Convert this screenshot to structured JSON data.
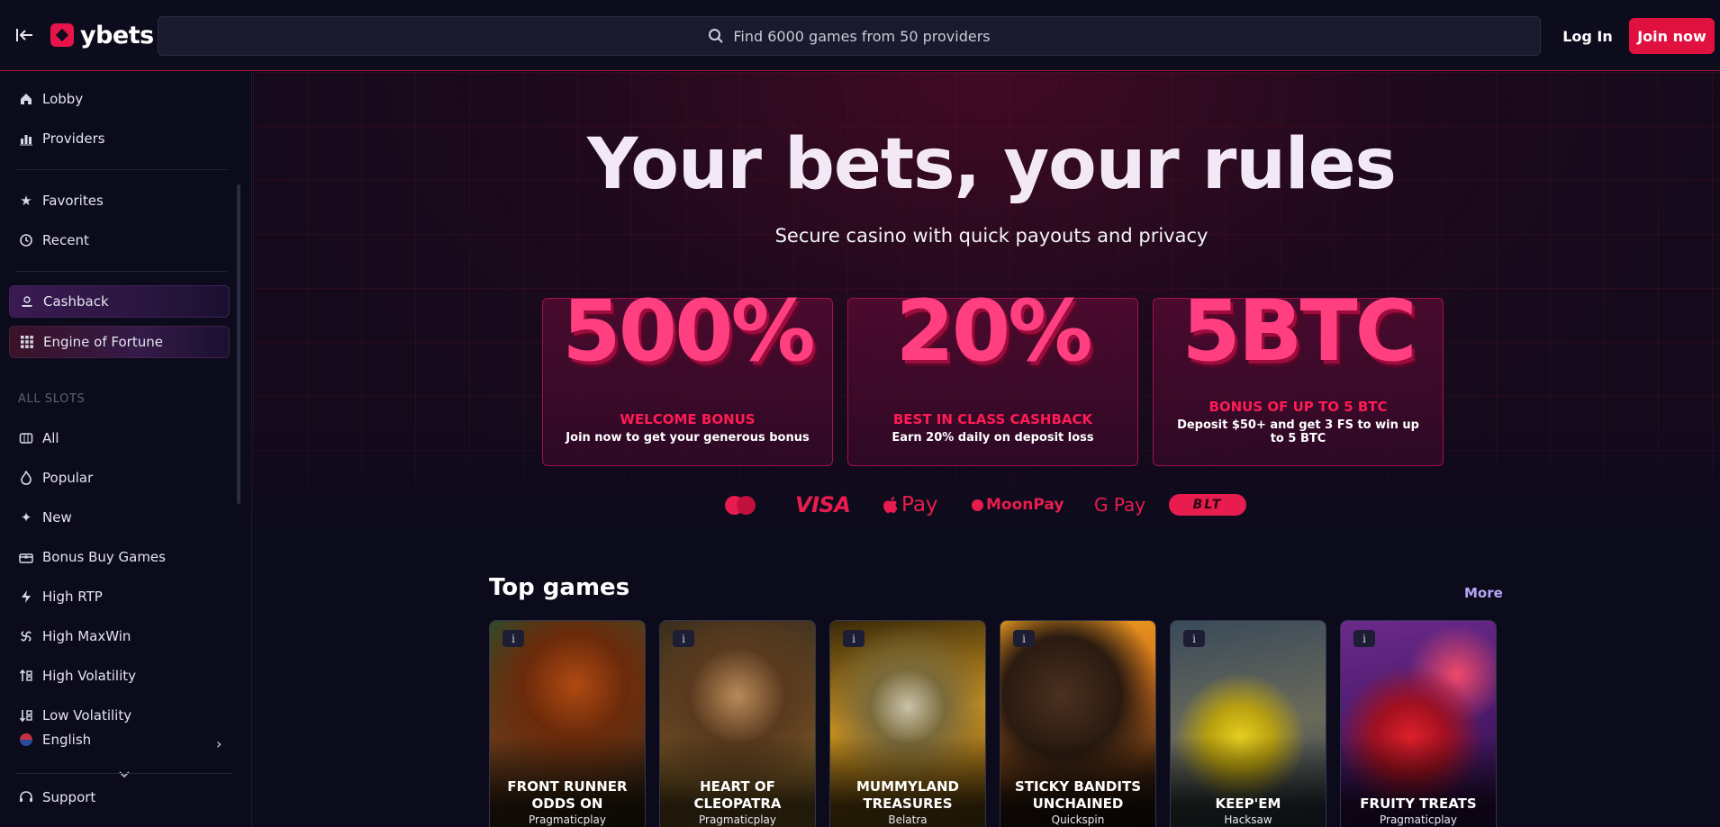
{
  "header": {
    "logo_text": "ybets",
    "search_placeholder": "Find 6000 games from 50 providers",
    "login_label": "Log In",
    "join_label": "Join now"
  },
  "sidebar": {
    "items": [
      {
        "label": "Lobby",
        "icon": "home-icon"
      },
      {
        "label": "Providers",
        "icon": "chart-icon"
      },
      {
        "label": "Favorites",
        "icon": "star-icon"
      },
      {
        "label": "Recent",
        "icon": "history-icon"
      },
      {
        "label": "Cashback",
        "icon": "cashback-icon"
      },
      {
        "label": "Engine of Fortune",
        "icon": "grid-icon"
      }
    ],
    "slots_heading": "ALL SLOTS",
    "slots": [
      {
        "label": "All",
        "icon": "slot-machine-icon"
      },
      {
        "label": "Popular",
        "icon": "flame-icon"
      },
      {
        "label": "New",
        "icon": "sparkle-icon"
      },
      {
        "label": "Bonus Buy Games",
        "icon": "treasure-icon"
      },
      {
        "label": "High RTP",
        "icon": "lightning-icon"
      },
      {
        "label": "High MaxWin",
        "icon": "spin-icon"
      },
      {
        "label": "High Volatility",
        "icon": "volatility-icon"
      },
      {
        "label": "Low Volatility",
        "icon": "volatility-low-icon"
      }
    ],
    "language": "English",
    "support": "Support"
  },
  "hero": {
    "title": "Your bets, your rules",
    "subtitle": "Secure casino with quick payouts and privacy"
  },
  "promos": [
    {
      "big": "500%",
      "label": "WELCOME BONUS",
      "desc": "Join now to get your generous bonus"
    },
    {
      "big": "20%",
      "label": "BEST IN CLASS CASHBACK",
      "desc": "Earn 20% daily on deposit loss"
    },
    {
      "big": "5BTC",
      "label": "BONUS OF UP TO 5 BTC",
      "desc": "Deposit $50+ and get 3 FS to win up to 5 BTC"
    }
  ],
  "payments": {
    "visa": "VISA",
    "applepay": "Pay",
    "moonpay": "MoonPay",
    "gpay": "G Pay",
    "crypto": "BLT"
  },
  "top_games": {
    "title": "Top games",
    "more": "More",
    "info_glyph": "i",
    "games": [
      {
        "name": "FRONT RUNNER ODDS ON",
        "provider": "Pragmaticplay"
      },
      {
        "name": "HEART OF CLEOPATRA",
        "provider": "Pragmaticplay"
      },
      {
        "name": "MUMMYLAND TREASURES",
        "provider": "Belatra"
      },
      {
        "name": "STICKY BANDITS UNCHAINED",
        "provider": "Quickspin"
      },
      {
        "name": "KEEP'EM",
        "provider": "Hacksaw"
      },
      {
        "name": "FRUITY TREATS",
        "provider": "Pragmaticplay"
      }
    ]
  },
  "colors": {
    "accent": "#e0103f",
    "promo_text": "#ff1b55",
    "more_link": "#b4a6f6"
  }
}
